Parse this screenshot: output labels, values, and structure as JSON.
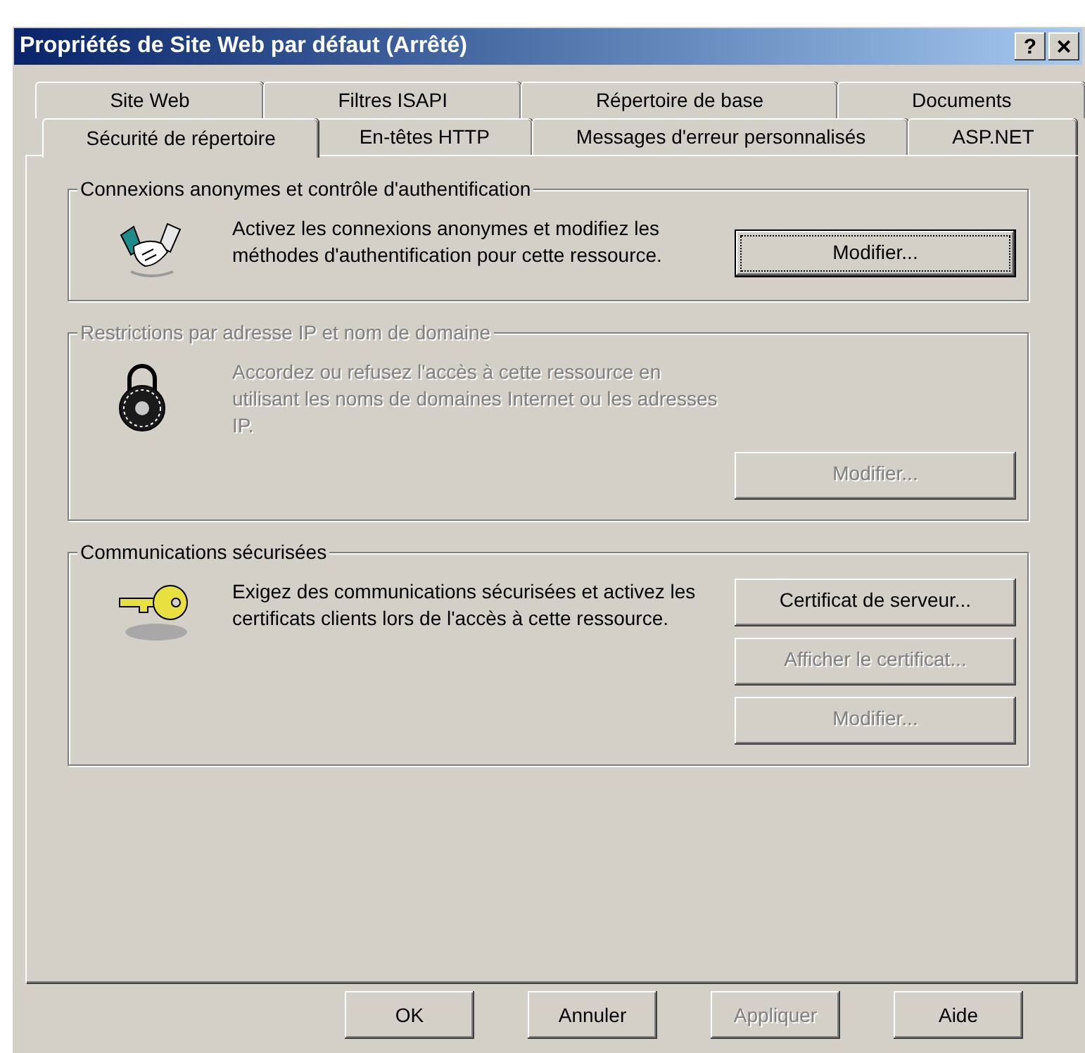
{
  "window": {
    "title": "Propriétés de Site Web par défaut (Arrêté)",
    "help_button": "?",
    "close_button": "×"
  },
  "tab_rows": [
    {
      "tabs": [
        {
          "label": "Site Web",
          "selected": false
        },
        {
          "label": "Filtres ISAPI",
          "selected": false
        },
        {
          "label": "Répertoire de base",
          "selected": false
        },
        {
          "label": "Documents",
          "selected": false
        }
      ]
    },
    {
      "tabs": [
        {
          "label": "Sécurité de répertoire",
          "selected": true
        },
        {
          "label": "En-têtes HTTP",
          "selected": false
        },
        {
          "label": "Messages d'erreur personnalisés",
          "selected": false
        },
        {
          "label": "ASP.NET",
          "selected": false
        }
      ]
    }
  ],
  "groups": [
    {
      "title": "Connexions anonymes et contrôle d'authentification",
      "disabled": false,
      "description": "Activez les connexions anonymes et modifiez les méthodes d'authentification pour cette ressource.",
      "buttons": [
        {
          "label": "Modifier...",
          "disabled": false,
          "focused": true
        }
      ]
    },
    {
      "title": "Restrictions par adresse IP et nom de domaine",
      "disabled": true,
      "description": "Accordez ou refusez l'accès à cette ressource en utilisant les noms de domaines Internet ou les adresses IP.",
      "buttons": [
        {
          "label": "Modifier...",
          "disabled": true,
          "focused": false
        }
      ]
    },
    {
      "title": "Communications sécurisées",
      "disabled": false,
      "description": "Exigez des communications sécurisées et activez les certificats clients lors de l'accès à cette ressource.",
      "buttons": [
        {
          "label": "Certificat de serveur...",
          "disabled": false,
          "focused": false
        },
        {
          "label": "Afficher le certificat...",
          "disabled": true,
          "focused": false
        },
        {
          "label": "Modifier...",
          "disabled": true,
          "focused": false
        }
      ]
    }
  ],
  "footer_buttons": [
    {
      "label": "OK",
      "disabled": false
    },
    {
      "label": "Annuler",
      "disabled": false
    },
    {
      "label": "Appliquer",
      "disabled": true
    },
    {
      "label": "Aide",
      "disabled": false
    }
  ]
}
